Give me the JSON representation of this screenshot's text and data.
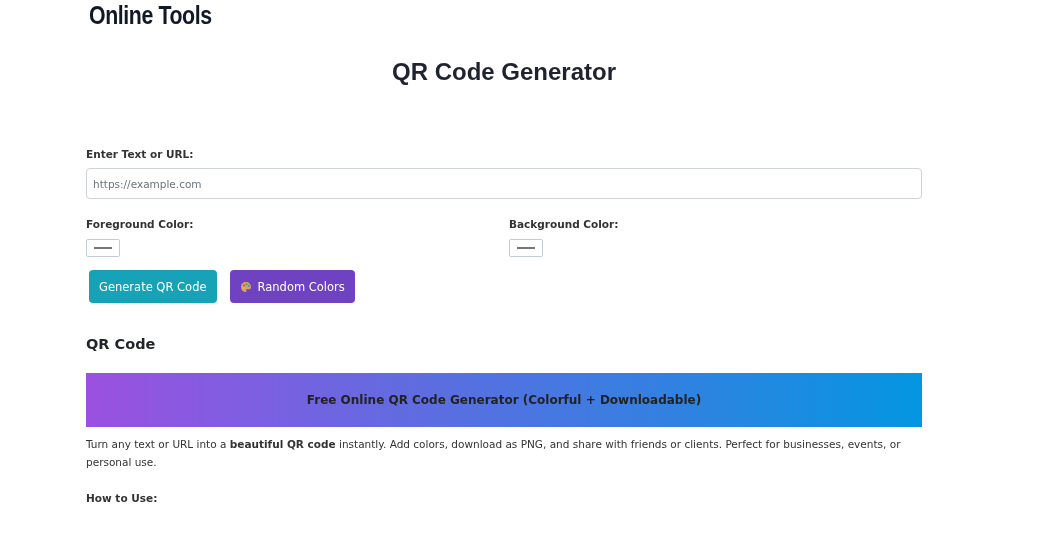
{
  "logo": "Online Tools",
  "title": "QR Code Generator",
  "input": {
    "label": "Enter Text or URL:",
    "placeholder": "https://example.com"
  },
  "colors": [
    {
      "label": "Foreground Color:"
    },
    {
      "label": "Background Color:"
    }
  ],
  "buttons": [
    {
      "label": "Generate QR Code",
      "kind": "primary"
    },
    {
      "label": "Random Colors",
      "kind": "palette"
    }
  ],
  "qr_heading": "QR Code",
  "banner": "Free Online QR Code Generator (Colorful + Downloadable)",
  "description": "Turn any text or URL into a **beautiful QR code** instantly. Add colors, download as PNG, and share with friends or clients. Perfect for businesses, events, or personal use.",
  "how_to": "How to Use:"
}
